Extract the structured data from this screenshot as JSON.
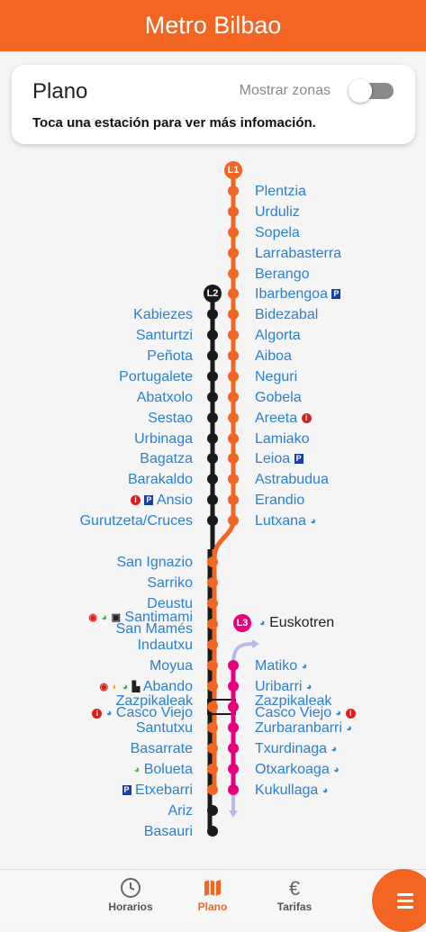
{
  "header": {
    "title": "Metro Bilbao"
  },
  "card": {
    "title": "Plano",
    "toggle_label": "Mostrar zonas",
    "toggle_on": false,
    "subtitle": "Toca una estación para ver más infomación."
  },
  "lines": {
    "l1": {
      "label": "L1",
      "color": "#f26522"
    },
    "l2": {
      "label": "L2",
      "color": "#1a1a1a"
    },
    "l3": {
      "label": "L3",
      "color": "#e6007e"
    },
    "l3_operator": "Euskotren"
  },
  "stations": {
    "l1_north": [
      "Plentzia",
      "Urduliz",
      "Sopela",
      "Larrabasterra",
      "Berango",
      "Ibarbengoa",
      "Bidezabal",
      "Algorta",
      "Aiboa",
      "Neguri",
      "Gobela",
      "Areeta",
      "Lamiako",
      "Leioa",
      "Astrabudua",
      "Erandio",
      "Lutxana"
    ],
    "l2_north": [
      "Kabiezes",
      "Santurtzi",
      "Peñota",
      "Portugalete",
      "Abatxolo",
      "Sestao",
      "Urbinaga",
      "Bagatza",
      "Barakaldo",
      "Ansio",
      "Gurutzeta/Cruces"
    ],
    "trunk": [
      "San Ignazio",
      "Sarriko",
      "Deustu",
      "Santimami",
      "San Mamés",
      "Indautxu",
      "Moyua",
      "Abando",
      "Zazpikaleak",
      "Casco Viejo",
      "Santutxu",
      "Basarrate",
      "Bolueta",
      "Etxebarri",
      "Ariz",
      "Basauri"
    ],
    "l3": [
      "Matiko",
      "Uribarri",
      "Zazpikaleak",
      "Casco Viejo",
      "Zurbaranbarri",
      "Txurdinaga",
      "Otxarkoaga",
      "Kukullaga"
    ]
  },
  "icons": {
    "parking": "P",
    "info": "i",
    "euskotren": "euskotren-icon",
    "bus": "bus-icon",
    "bizkaibus": "bizkaibus-icon",
    "renfe": "renfe-icon",
    "tram": "tram-icon",
    "feve": "feve-icon"
  },
  "nav": {
    "tabs": [
      {
        "label": "Horarios",
        "icon": "clock-icon"
      },
      {
        "label": "Plano",
        "icon": "map-icon",
        "active": true
      },
      {
        "label": "Tarifas",
        "icon": "euro-icon"
      }
    ],
    "menu_icon": "menu-icon"
  },
  "colors": {
    "brand": "#f26522",
    "station_text": "#2a7fd1",
    "l3": "#e6007e"
  }
}
